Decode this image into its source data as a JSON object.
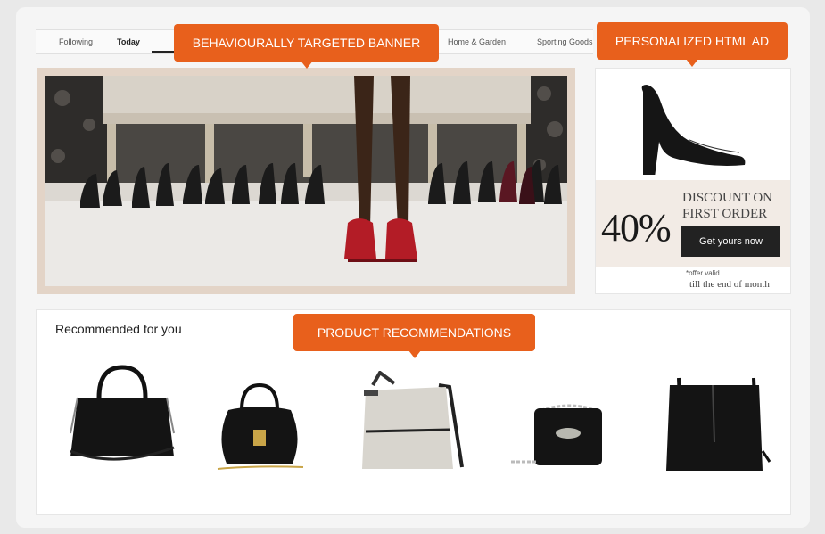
{
  "nav": {
    "items": [
      "Following",
      "Today",
      "Home & Garden",
      "Sporting Goods"
    ],
    "active": "Today"
  },
  "callouts": {
    "banner": "BEHAVIOURALLY TARGETED BANNER",
    "ad": "PERSONALIZED HTML AD",
    "reco": "PRODUCT RECOMMENDATIONS"
  },
  "ad": {
    "percent": "40%",
    "discount_line1": "DISCOUNT ON",
    "discount_line2": "FIRST ORDER",
    "button": "Get yours now",
    "fine_line1": "*offer valid",
    "fine_line2": "till the end of month"
  },
  "recommendations": {
    "title": "Recommended for you",
    "products": [
      "black-tote-bag",
      "black-saddle-bag",
      "grey-crossbody-bag",
      "black-chain-bag",
      "black-bucket-bag"
    ]
  },
  "colors": {
    "accent": "#e8601c",
    "banner_frame": "#e3d4c7",
    "ad_band": "#f2ebe5"
  }
}
